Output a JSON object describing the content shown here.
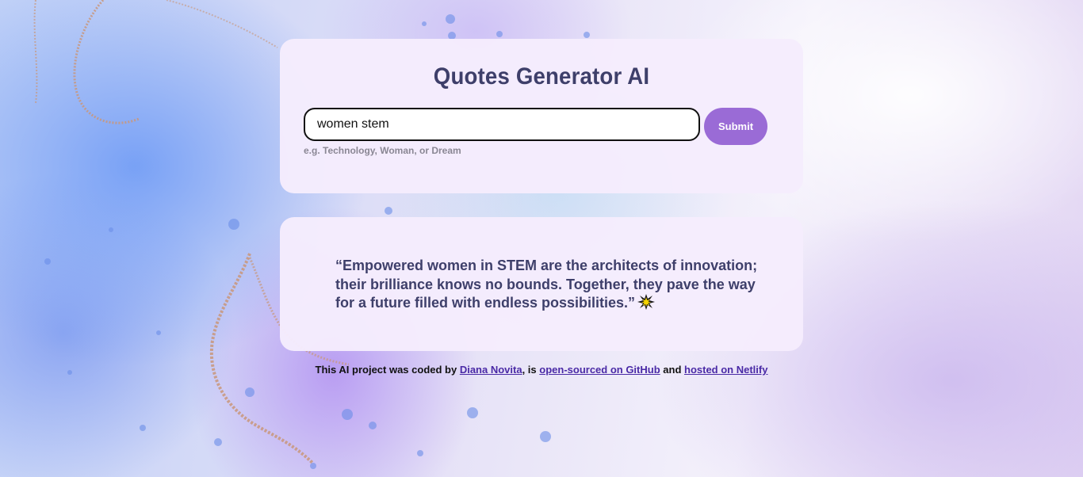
{
  "app": {
    "title": "Quotes Generator AI"
  },
  "search": {
    "value": "women stem",
    "hint": "e.g. Technology, Woman, or Dream",
    "submit_label": "Submit"
  },
  "quote": {
    "text": "“Empowered women in STEM are the architects of innovation; their brilliance knows no bounds. Together, they pave the way for a future filled with endless possibilities.”",
    "icon": "sparkle-icon"
  },
  "footer": {
    "prefix": "This AI project was coded by ",
    "author_link": "Diana Novita",
    "middle1": ", is ",
    "github_link": "open-sourced on GitHub",
    "middle2": " and ",
    "netlify_link": "hosted on Netlify"
  },
  "colors": {
    "heading": "#3e3f6a",
    "submit_bg": "#9a6bd6",
    "card_bg": "#f5ecfd",
    "link": "#4a2aa6"
  }
}
